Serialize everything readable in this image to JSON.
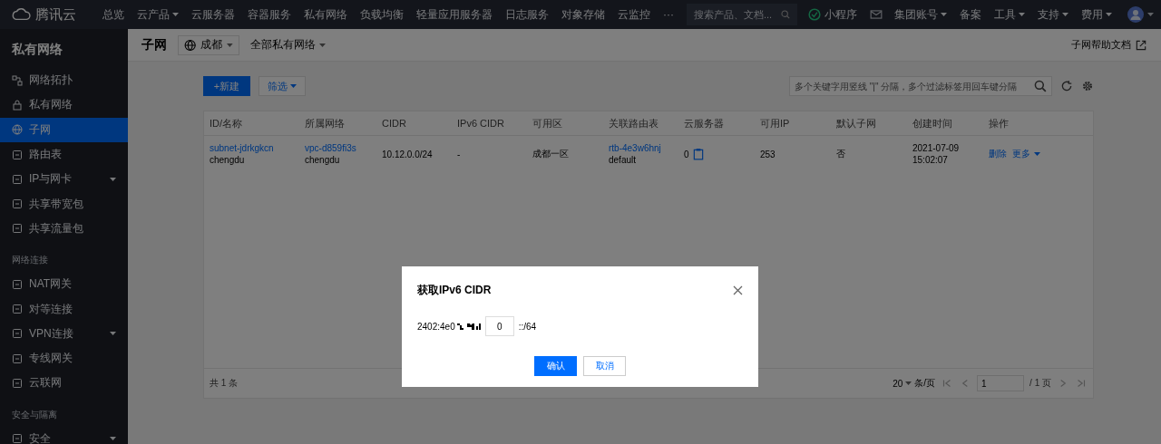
{
  "topbar": {
    "logo": "腾讯云",
    "nav": [
      {
        "label": "总览",
        "dropdown": false
      },
      {
        "label": "云产品",
        "dropdown": true
      },
      {
        "label": "云服务器",
        "dropdown": false
      },
      {
        "label": "容器服务",
        "dropdown": false
      },
      {
        "label": "私有网络",
        "dropdown": false
      },
      {
        "label": "负载均衡",
        "dropdown": false
      },
      {
        "label": "轻量应用服务器",
        "dropdown": false
      },
      {
        "label": "日志服务",
        "dropdown": false
      },
      {
        "label": "对象存储",
        "dropdown": false
      },
      {
        "label": "云监控",
        "dropdown": false
      },
      {
        "label": "···",
        "dropdown": false
      }
    ],
    "search": {
      "placeholder": "搜索产品、文档..."
    },
    "mini_program": "小程序",
    "right": [
      {
        "label": "集团账号",
        "dropdown": true
      },
      {
        "label": "备案",
        "dropdown": false
      },
      {
        "label": "工具",
        "dropdown": true
      },
      {
        "label": "支持",
        "dropdown": true
      },
      {
        "label": "费用",
        "dropdown": true
      }
    ]
  },
  "sidebar": {
    "title": "私有网络",
    "groups": [
      {
        "items": [
          {
            "label": "网络拓扑",
            "selected": false,
            "submenu": false
          },
          {
            "label": "私有网络",
            "selected": false,
            "submenu": false
          },
          {
            "label": "子网",
            "selected": true,
            "submenu": false
          },
          {
            "label": "路由表",
            "selected": false,
            "submenu": false
          },
          {
            "label": "IP与网卡",
            "selected": false,
            "submenu": true
          },
          {
            "label": "共享带宽包",
            "selected": false,
            "submenu": false
          },
          {
            "label": "共享流量包",
            "selected": false,
            "submenu": false
          }
        ]
      },
      {
        "heading": "网络连接",
        "items": [
          {
            "label": "NAT网关",
            "selected": false,
            "submenu": false
          },
          {
            "label": "对等连接",
            "selected": false,
            "submenu": false
          },
          {
            "label": "VPN连接",
            "selected": false,
            "submenu": true
          },
          {
            "label": "专线网关",
            "selected": false,
            "submenu": false
          },
          {
            "label": "云联网",
            "selected": false,
            "submenu": false
          }
        ]
      },
      {
        "heading": "安全与隔离",
        "items": [
          {
            "label": "安全",
            "selected": false,
            "submenu": true
          }
        ]
      }
    ]
  },
  "header": {
    "title": "子网",
    "region": "成都",
    "vpc_filter": "全部私有网络",
    "help_link": "子网帮助文档"
  },
  "toolbar": {
    "new_button": "+新建",
    "filter_button": "筛选",
    "search": {
      "placeholder": "多个关键字用竖线 \"|\" 分隔，多个过滤标签用回车键分隔"
    }
  },
  "table": {
    "columns": [
      "ID/名称",
      "所属网络",
      "CIDR",
      "IPv6 CIDR",
      "可用区",
      "关联路由表",
      "云服务器",
      "可用IP",
      "默认子网",
      "创建时间",
      "操作"
    ],
    "rows": [
      {
        "id": "subnet-jdrkgkcn",
        "name": "chengdu",
        "vpc_id": "vpc-d859fi3s",
        "vpc_name": "chengdu",
        "cidr": "10.12.0.0/24",
        "ipv6_cidr": "-",
        "zone": "成都一区",
        "route_table_id": "rtb-4e3w6hnj",
        "route_table_name": "default",
        "servers": "0",
        "available_ip": "253",
        "default_subnet": "否",
        "created": [
          "2021-07-09",
          "15:02:07"
        ],
        "actions": [
          "删除",
          "更多"
        ]
      }
    ],
    "footer": {
      "total": "共 1 条",
      "page_size": "20",
      "page_size_unit": "条/页",
      "page": "1",
      "pages": "/ 1 页"
    }
  },
  "dialog": {
    "title": "获取IPv6 CIDR",
    "prefix": "2402:4e0",
    "input_value": "0",
    "suffix": "::/64",
    "buttons": [
      {
        "label": "确认",
        "kind": "primary"
      },
      {
        "label": "取消",
        "kind": "default"
      }
    ]
  }
}
